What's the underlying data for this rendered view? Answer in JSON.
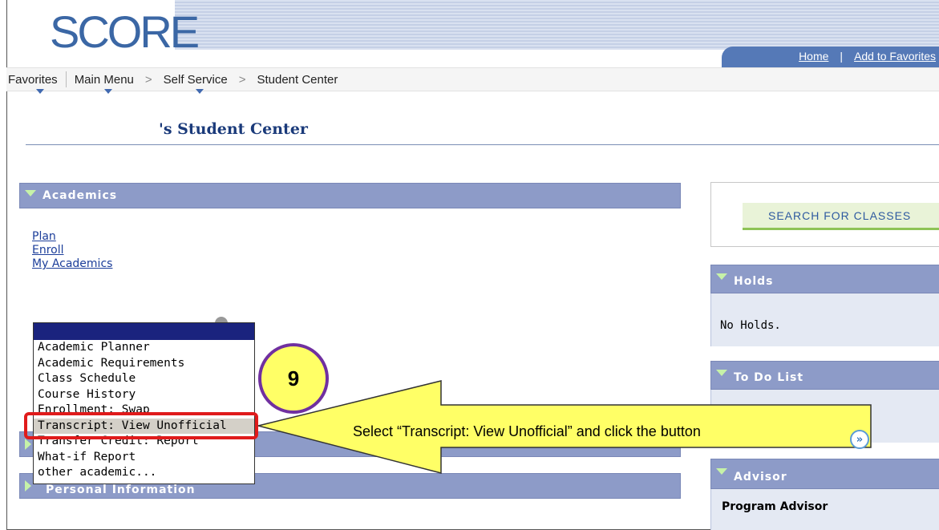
{
  "app": {
    "logo": "SCORE"
  },
  "topnav": {
    "home": "Home",
    "separator": "|",
    "add_to_favorites": "Add to Favorites"
  },
  "breadcrumb": {
    "favorites": "Favorites",
    "main_menu": "Main Menu",
    "arrow1": ">",
    "self_service": "Self Service",
    "arrow2": ">",
    "student_center": "Student Center"
  },
  "page": {
    "title": "'s Student Center"
  },
  "academics": {
    "header": "Academics",
    "links": [
      "Plan",
      "Enroll",
      "My Academics"
    ]
  },
  "dropdown": {
    "options": [
      "Academic Planner",
      "Academic Requirements",
      "Class Schedule",
      "Course History",
      "Enrollment: Swap",
      "Transcript: View Unofficial",
      "Transfer Credit: Report",
      "What-if Report",
      "other academic..."
    ],
    "selected": "Transcript: View Unofficial"
  },
  "personal_info": {
    "header": "Personal Information"
  },
  "search": {
    "button": "SEARCH FOR CLASSES"
  },
  "holds": {
    "header": "Holds",
    "text": "No Holds."
  },
  "todo": {
    "header": "To Do List"
  },
  "advisor": {
    "header": "Advisor",
    "program_advisor": "Program Advisor"
  },
  "callout": {
    "step": "9",
    "instruction": "Select “Transcript: View Unofficial” and click the button",
    "go_glyph": "»"
  },
  "colors": {
    "section_header": "#8d9bc8",
    "callout_fill": "#ffff66",
    "badge_border": "#7030a0",
    "highlight": "#e01b1b"
  }
}
